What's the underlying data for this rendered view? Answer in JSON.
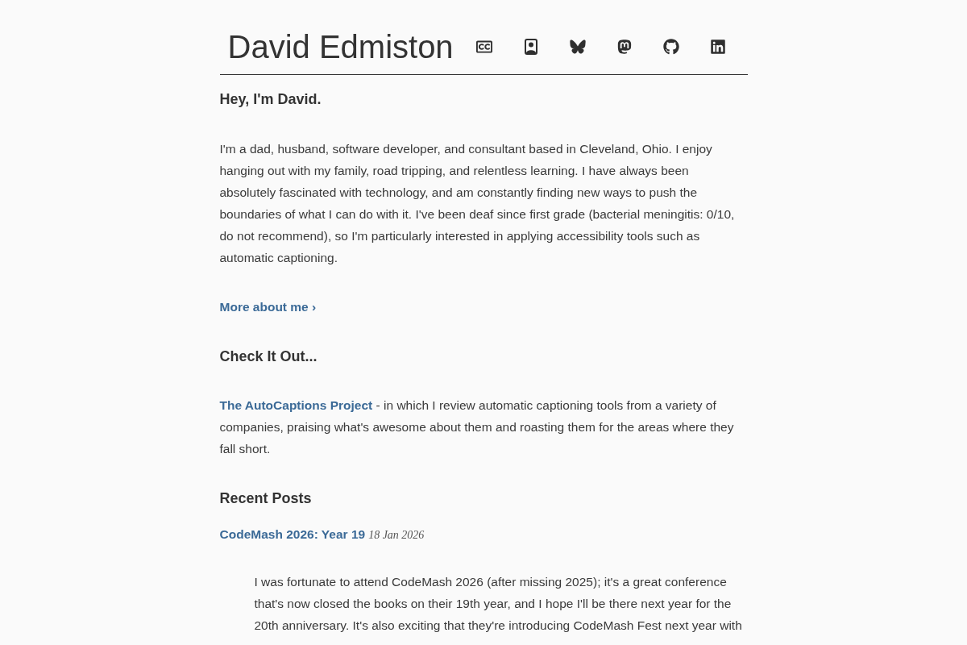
{
  "header": {
    "title": "David Edmiston",
    "links": [
      {
        "kind": "captions"
      },
      {
        "kind": "contact"
      },
      {
        "kind": "butterfly"
      },
      {
        "kind": "mastodon"
      },
      {
        "kind": "github"
      },
      {
        "kind": "linkedin"
      }
    ]
  },
  "intro": {
    "heading": "Hey, I'm David.",
    "text": "I'm a dad, husband, software developer, and consultant based in Cleveland, Ohio. I enjoy hanging out with my family, road tripping, and relentless learning. I have always been absolutely fascinated with technology, and am constantly finding new ways to push the boundaries of what I can do with it. I've been deaf since first grade (bacterial meningitis: 0/10, do not recommend), so I'm particularly interested in applying accessibility tools such as automatic captioning.",
    "link": "More about me ›"
  },
  "check_it_out": {
    "heading": "Check It Out...",
    "link": "The AutoCaptions Project",
    "text": "- in which I review automatic captioning tools from a variety of companies, praising what's awesome about them and roasting them for the areas where they fall short."
  },
  "recent_posts": {
    "heading": "Recent Posts",
    "posts": [
      {
        "title": "CodeMash 2026: Year 19",
        "date": "18 Jan 2026",
        "excerpt": "I was fortunate to attend CodeMash 2026 (after missing 2025); it's a great conference that's now closed the books on their 19th year, and I hope I'll be there next year for the 20th anniversary. It's also exciting that they're introducing CodeMash Fest next year with"
      }
    ]
  }
}
